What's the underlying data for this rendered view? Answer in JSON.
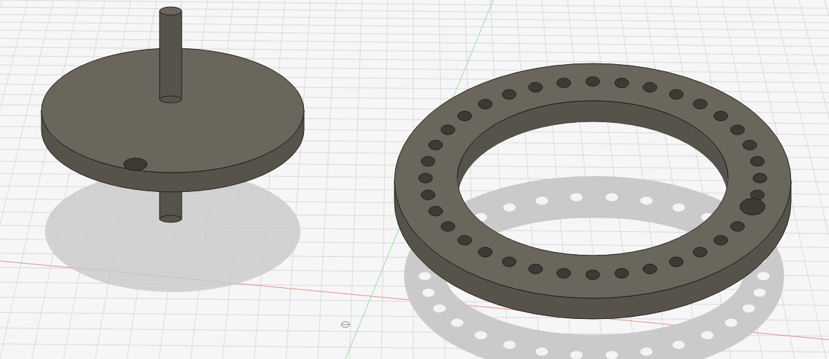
{
  "viewport": {
    "grid": true,
    "axes": true,
    "objects": [
      {
        "kind": "disc-with-shaft"
      },
      {
        "kind": "ring-with-holes"
      }
    ]
  }
}
